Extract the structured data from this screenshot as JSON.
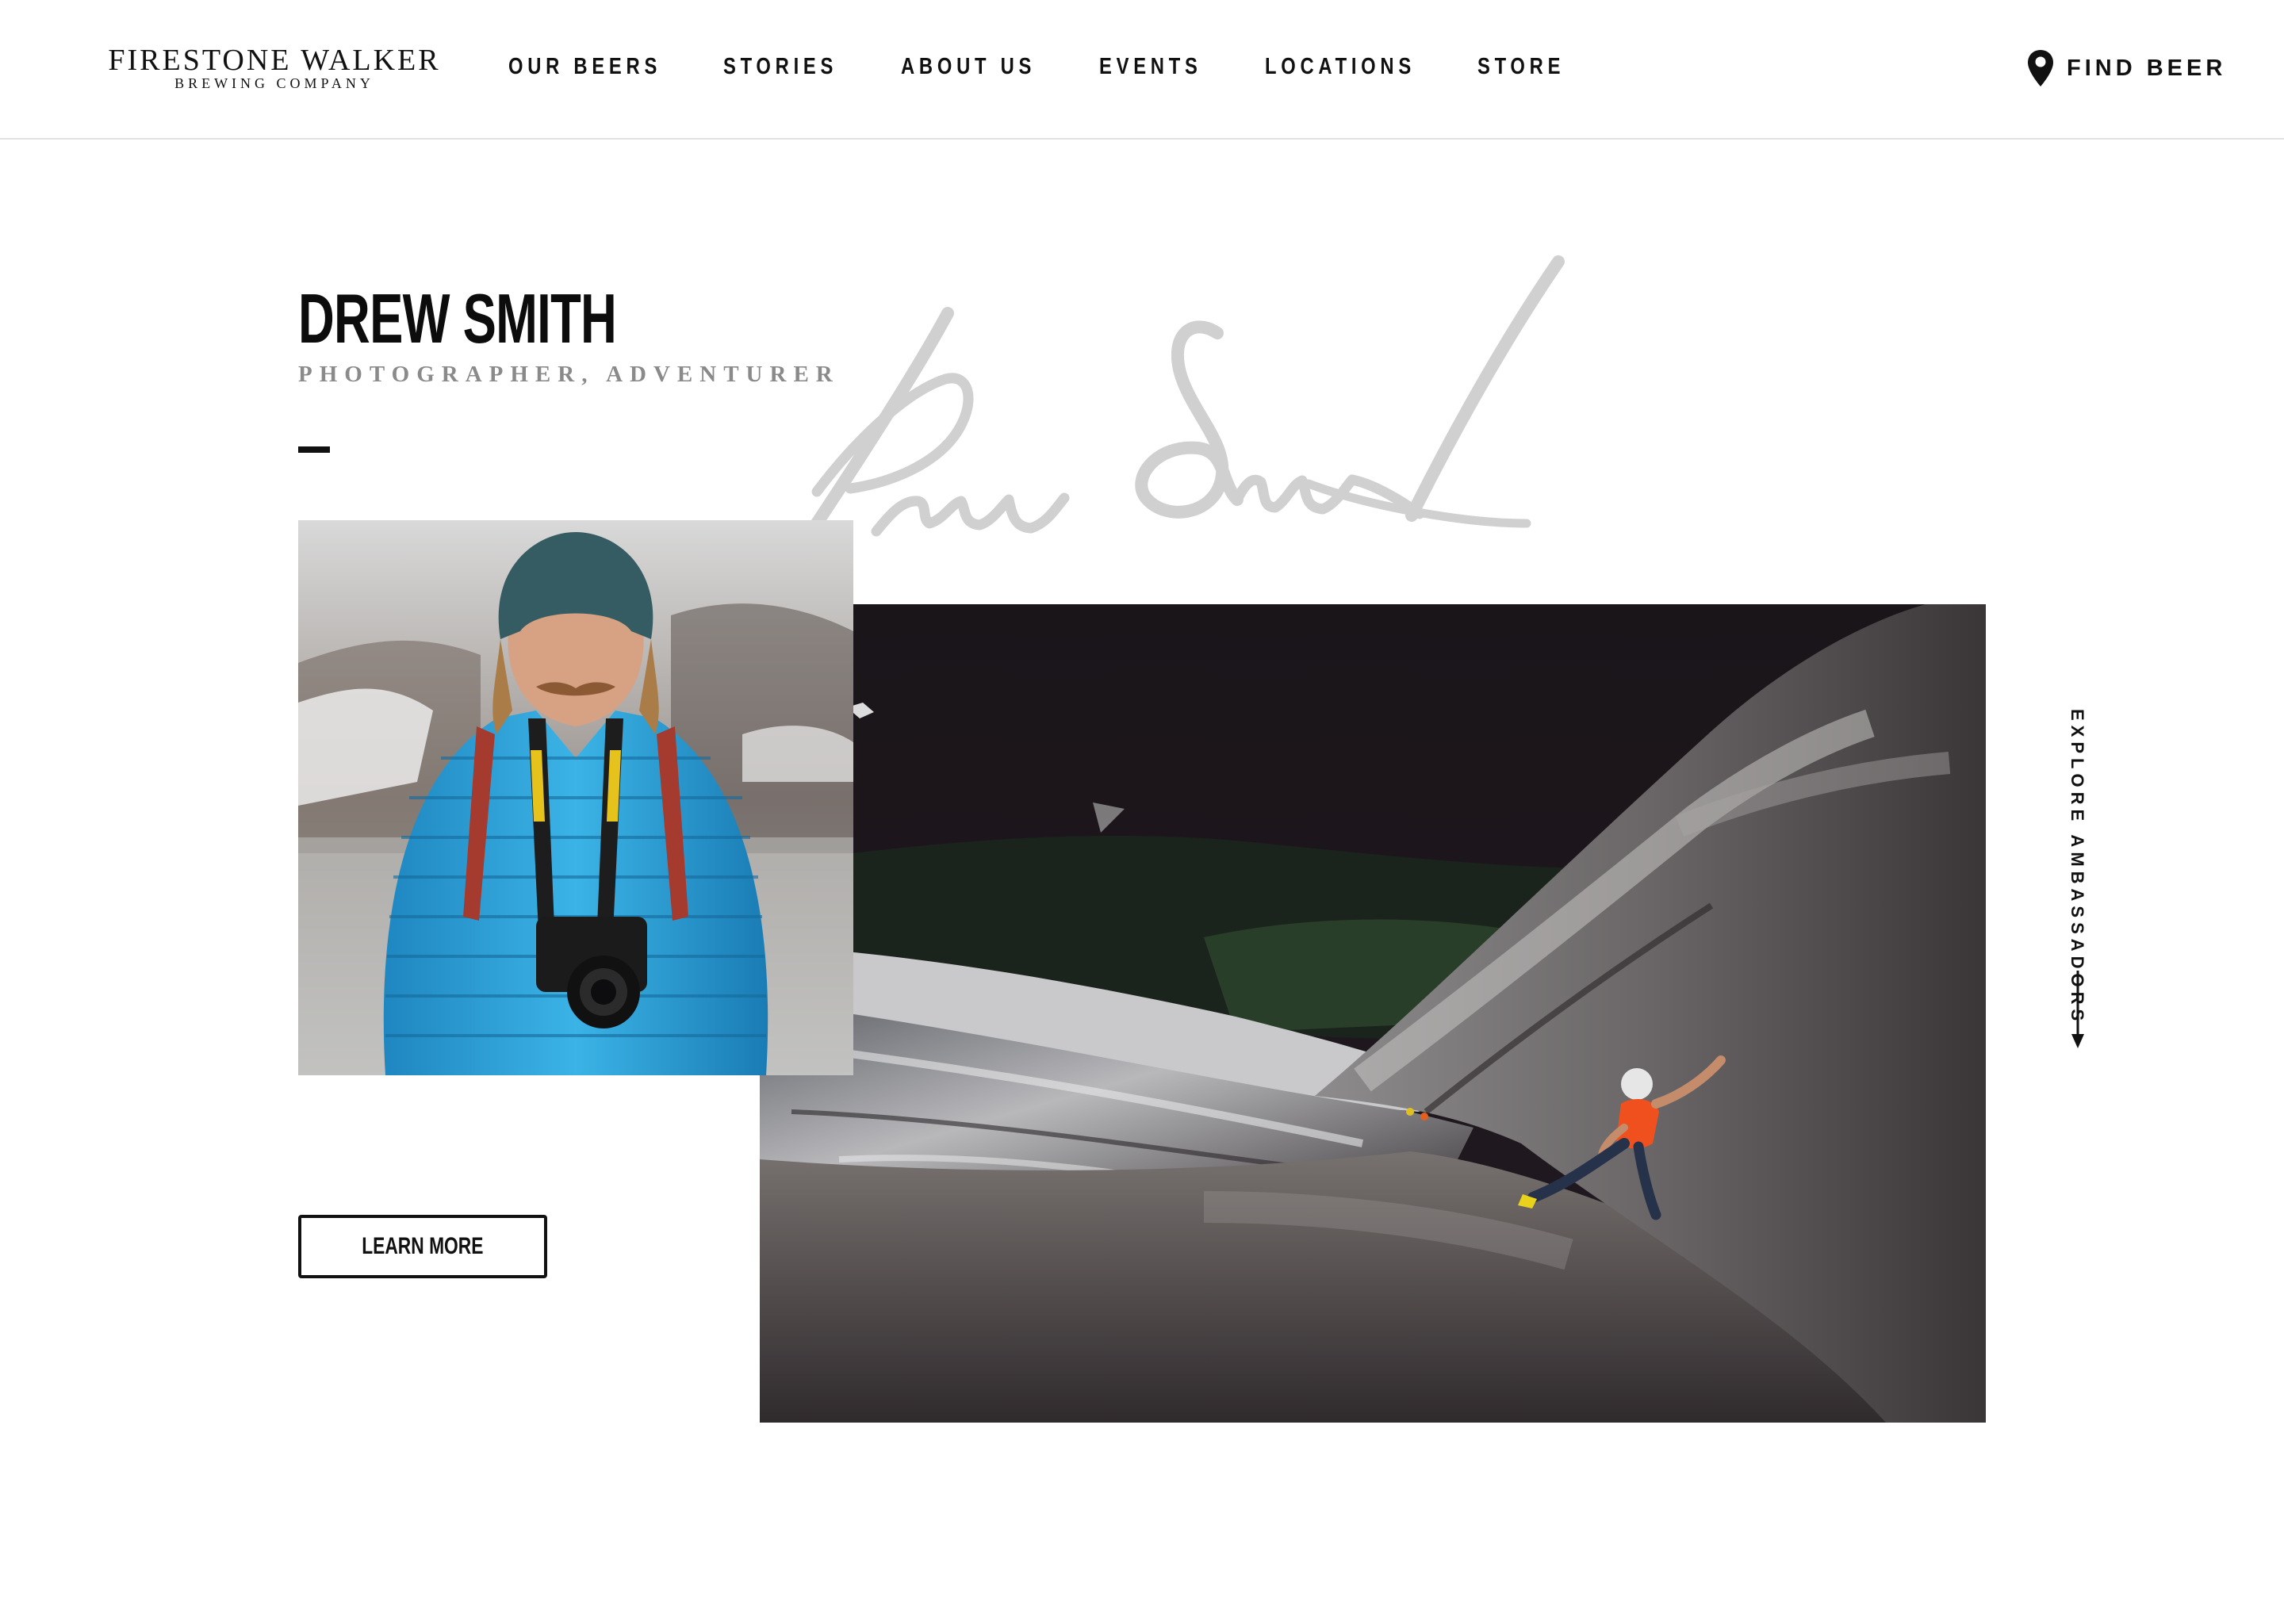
{
  "brand": {
    "name": "FIRESTONE WALKER",
    "tagline": "BREWING COMPANY"
  },
  "nav": {
    "items": [
      {
        "label": "OUR BEERS"
      },
      {
        "label": "STORIES"
      },
      {
        "label": "ABOUT US"
      },
      {
        "label": "EVENTS"
      },
      {
        "label": "LOCATIONS"
      },
      {
        "label": "STORE"
      }
    ],
    "find_beer": {
      "label": "FIND BEER",
      "icon": "map-pin-icon"
    }
  },
  "ambassador": {
    "name": "DREW SMITH",
    "role": "PHOTOGRAPHER, ADVENTURER",
    "signature_text": "Drew Smith"
  },
  "cta": {
    "learn_more": "LEARN MORE"
  },
  "side_link": {
    "label": "EXPLORE AMBASSADORS",
    "icon": "arrow-down-icon"
  },
  "colors": {
    "text": "#111111",
    "muted": "#8a8a8a",
    "signature": "#d0d0d0",
    "jacket": "#2a9fd6",
    "climber_shirt": "#f0501e"
  }
}
